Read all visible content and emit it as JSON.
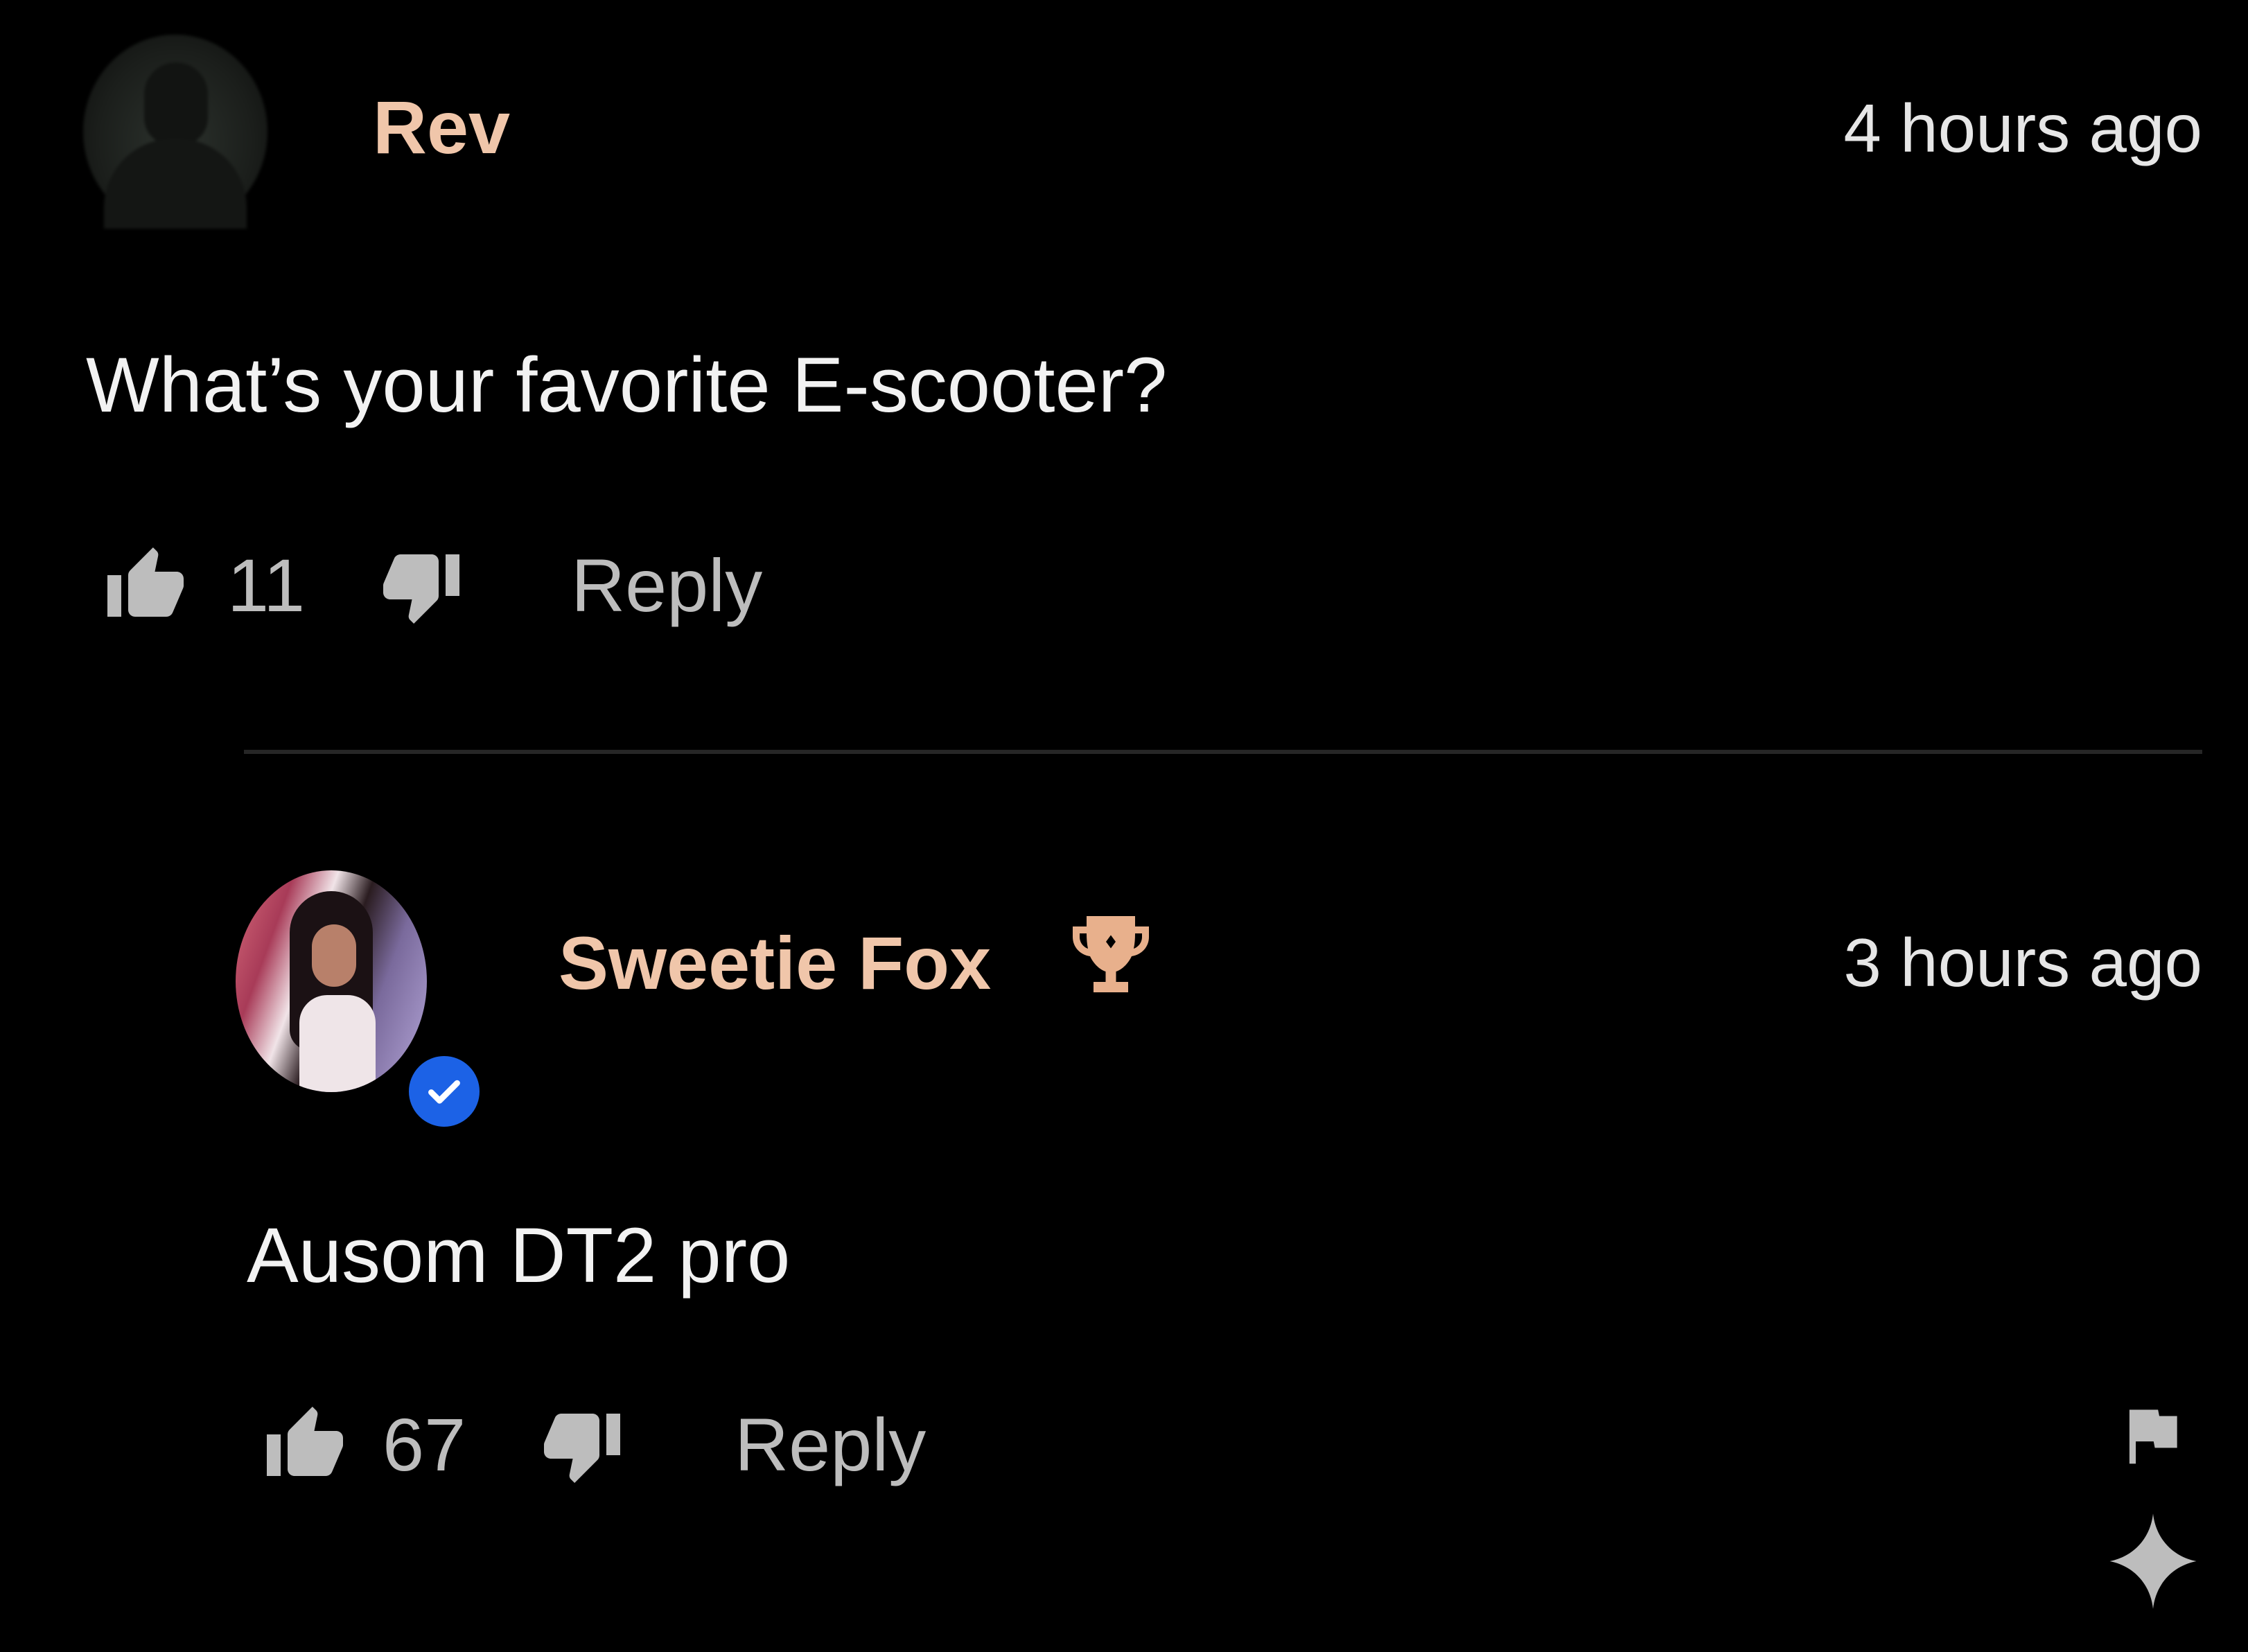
{
  "thread": {
    "comment": {
      "author": "Rev",
      "timestamp": "4 hours ago",
      "text": "What’s your favorite E-scooter?",
      "likes": "11",
      "reply_label": "Reply"
    },
    "reply": {
      "author": "Sweetie Fox",
      "badge": "trophy-icon",
      "verified": true,
      "timestamp": "3 hours ago",
      "text": "Ausom DT2 pro",
      "likes": "67",
      "reply_label": "Reply"
    }
  },
  "colors": {
    "background": "#000000",
    "username": "#f0c6aa",
    "verified_badge": "#1c62e6",
    "trophy": "#e8b08c"
  },
  "icons": [
    "thumbs-up-icon",
    "thumbs-down-icon",
    "trophy-icon",
    "checkmark-icon",
    "flag-icon",
    "sparkle-icon"
  ]
}
